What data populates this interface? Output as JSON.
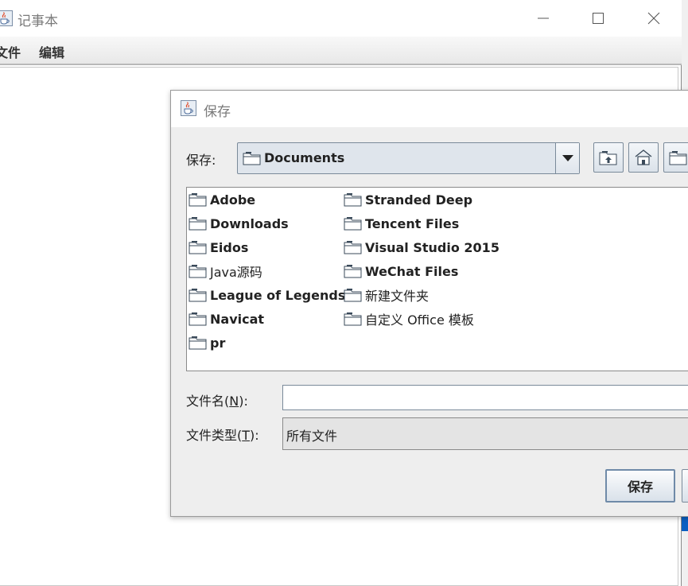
{
  "main_window": {
    "title": "记事本",
    "menu": {
      "file": "文件",
      "edit": "编辑"
    }
  },
  "dialog": {
    "title": "保存",
    "save_in_label": "保存:",
    "current_folder": "Documents",
    "file_name_label": {
      "prefix": "文件名(",
      "mnemonic": "N",
      "suffix": "):"
    },
    "file_name_value": "",
    "file_type_label": {
      "prefix": "文件类型(",
      "mnemonic": "T",
      "suffix": "):"
    },
    "file_type_value": "所有文件",
    "save_button": "保存",
    "files_col1": [
      "Adobe",
      "Downloads",
      "Eidos",
      "Java源码",
      "League of Legends",
      "Navicat",
      "pr"
    ],
    "files_col2": [
      "Stranded Deep",
      "Tencent Files",
      "Visual Studio 2015",
      "WeChat Files",
      "新建文件夹",
      "自定义 Office 模板"
    ]
  },
  "icons": {
    "app": "java-cup-icon",
    "folder": "folder-icon",
    "up_folder": "up-folder-icon",
    "home": "home-icon",
    "new_folder": "new-folder-icon"
  }
}
